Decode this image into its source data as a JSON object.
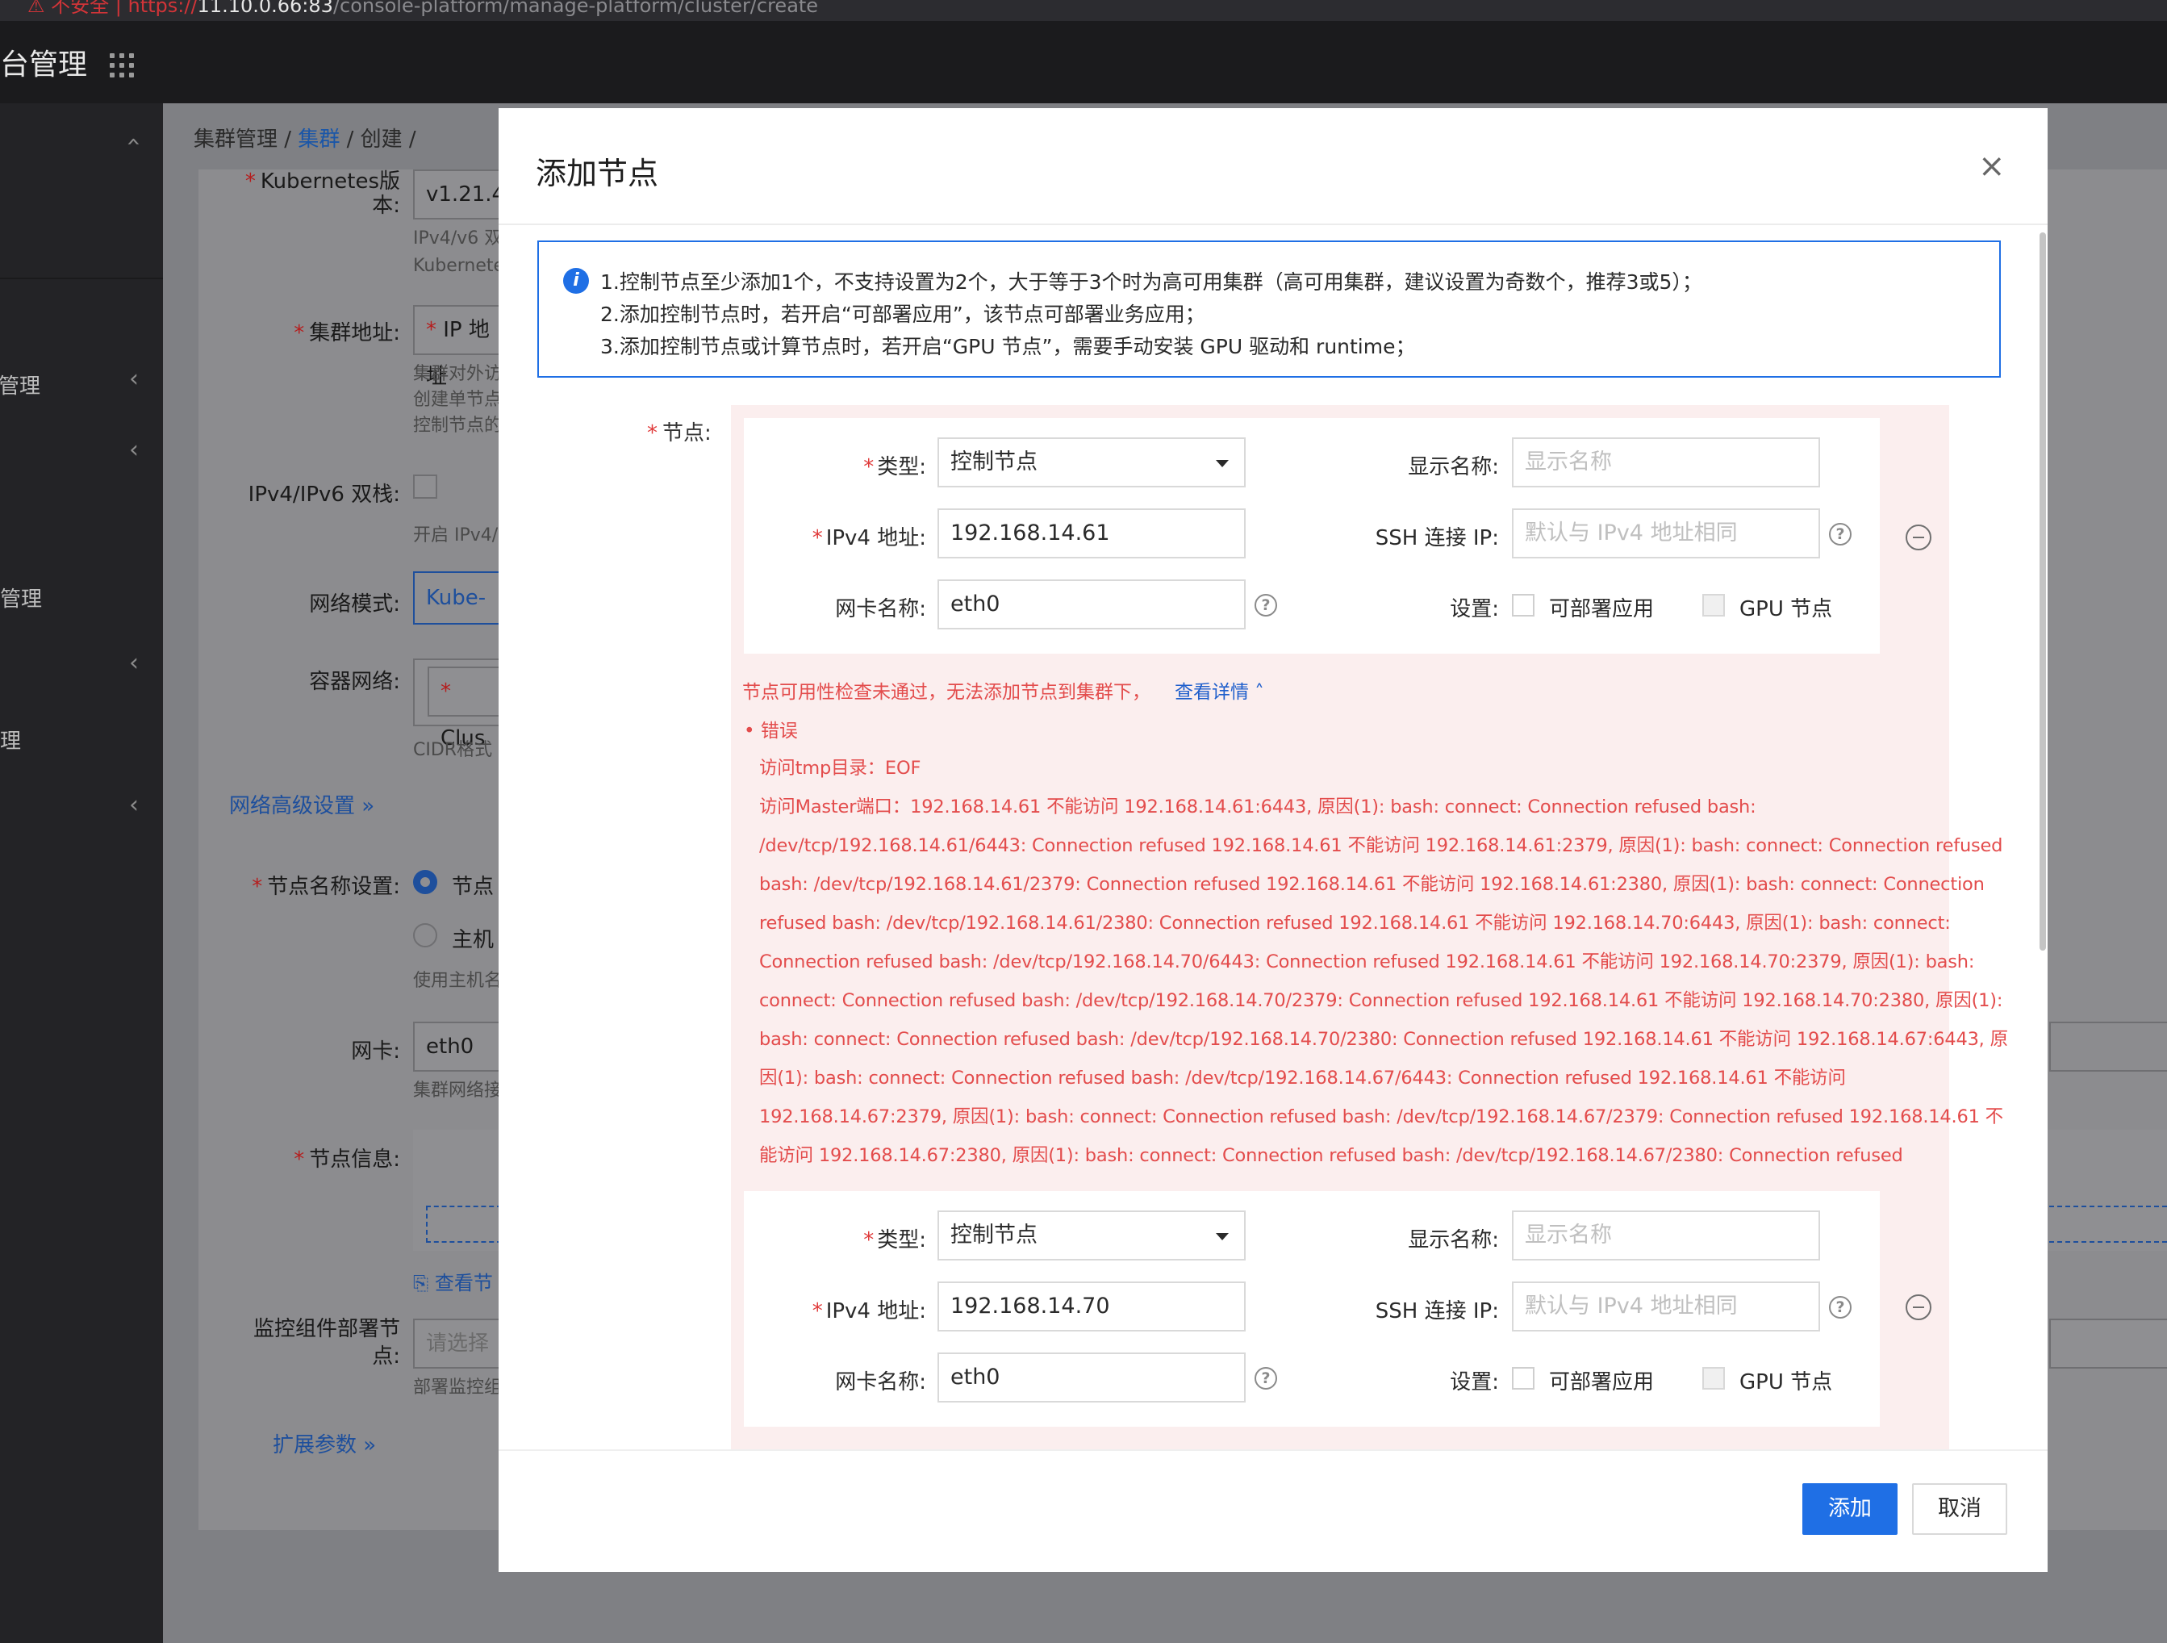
{
  "browser": {
    "security_warning": "⚠ 不安全 |",
    "url_scheme": "https://",
    "url_host": "11.10.0.66:83",
    "url_path": "/console-platform/manage-platform/cluster/create"
  },
  "app": {
    "title": "平台管理",
    "sidebar": {
      "items": [
        {
          "label": ""
        },
        {
          "label": "管理"
        },
        {
          "label": ""
        },
        {
          "label": "管理"
        },
        {
          "label": ""
        },
        {
          "label": "理"
        },
        {
          "label": ""
        }
      ]
    }
  },
  "background_page": {
    "breadcrumb": {
      "part1": "集群管理",
      "sep": " / ",
      "part2": "集群",
      "part3": "创建",
      "tail": " /"
    },
    "fields": {
      "k8s_label": "Kubernetes版本:",
      "k8s_value": "v1.21.4",
      "k8s_sub1": "IPv4/v6 双",
      "k8s_sub2": "Kuberneter",
      "addr_label": "集群地址:",
      "addr_value": "IP 地址",
      "addr_sub1": "集群对外访",
      "addr_sub2": "创建单节点",
      "addr_sub3": "控制节点的",
      "dual_label": "IPv4/IPv6 双栈:",
      "dual_sub": "开启 IPv4/",
      "net_label": "网络模式:",
      "net_value": "Kube-",
      "container_label": "容器网络:",
      "container_value": "Clus",
      "container_sub": "CIDR格式",
      "adv_link": "网络高级设置 »",
      "naming_label": "节点名称设置:",
      "naming_opt1": "节点",
      "naming_opt2": "主机",
      "naming_sub": "使用主机名",
      "nic_label": "网卡:",
      "nic_value": "eth0",
      "nic_sub": "集群网络接",
      "nodeinfo_label": "节点信息:",
      "view_link": "查看节",
      "monitor_label1": "监控组件部署节",
      "monitor_label2": "点:",
      "monitor_placeholder": "请选择",
      "monitor_sub": "部署监控组",
      "ext_link": "扩展参数 »"
    }
  },
  "modal": {
    "title": "添加节点",
    "close_icon": "×",
    "info_lines": [
      "1.控制节点至少添加1个，不支持设置为2个，大于等于3个时为高可用集群（高可用集群，建议设置为奇数个，推荐3或5）；",
      "2.添加控制节点时，若开启“可部署应用”，该节点可部署业务应用；",
      "3.添加控制节点或计算节点时，若开启“GPU 节点”，需要手动安装 GPU 驱动和 runtime；"
    ],
    "node_label": "节点:",
    "labels": {
      "type": "类型:",
      "ipv4": "IPv4 地址:",
      "nic": "网卡名称:",
      "display": "显示名称:",
      "ssh": "SSH 连接 IP:",
      "settings": "设置:",
      "deployable": "可部署应用",
      "gpu": "GPU 节点"
    },
    "placeholders": {
      "display": "显示名称",
      "ssh": "默认与 IPv4 地址相同"
    },
    "nodes": [
      {
        "type": "控制节点",
        "ipv4": "192.168.14.61",
        "nic": "eth0"
      },
      {
        "type": "控制节点",
        "ipv4": "192.168.14.70",
        "nic": "eth0"
      }
    ],
    "error": {
      "message": "节点可用性检查未通过，无法添加节点到集群下，",
      "details_link": "查看详情 ˄",
      "bullet": "• 错误",
      "lines": [
        "访问tmp目录：EOF",
        "访问Master端口：192.168.14.61 不能访问 192.168.14.61:6443, 原因(1): bash: connect: Connection refused bash:",
        "/dev/tcp/192.168.14.61/6443: Connection refused 192.168.14.61 不能访问 192.168.14.61:2379, 原因(1): bash: connect: Connection refused",
        "bash: /dev/tcp/192.168.14.61/2379: Connection refused 192.168.14.61 不能访问 192.168.14.61:2380, 原因(1): bash: connect: Connection",
        "refused bash: /dev/tcp/192.168.14.61/2380: Connection refused 192.168.14.61 不能访问 192.168.14.70:6443, 原因(1): bash: connect:",
        "Connection refused bash: /dev/tcp/192.168.14.70/6443: Connection refused 192.168.14.61 不能访问 192.168.14.70:2379, 原因(1): bash:",
        "connect: Connection refused bash: /dev/tcp/192.168.14.70/2379: Connection refused 192.168.14.61 不能访问 192.168.14.70:2380, 原因(1):",
        "bash: connect: Connection refused bash: /dev/tcp/192.168.14.70/2380: Connection refused 192.168.14.61 不能访问 192.168.14.67:6443, 原",
        "因(1): bash: connect: Connection refused bash: /dev/tcp/192.168.14.67/6443: Connection refused 192.168.14.61 不能访问",
        "192.168.14.67:2379, 原因(1): bash: connect: Connection refused bash: /dev/tcp/192.168.14.67/2379: Connection refused 192.168.14.61 不",
        "能访问 192.168.14.67:2380, 原因(1): bash: connect: Connection refused bash: /dev/tcp/192.168.14.67/2380: Connection refused"
      ]
    },
    "buttons": {
      "add": "添加",
      "cancel": "取消"
    }
  },
  "colors": {
    "primary": "#1f6fe5",
    "error": "#e34c4c",
    "error_bg": "#fbeeee",
    "required": "#e03b3b"
  }
}
